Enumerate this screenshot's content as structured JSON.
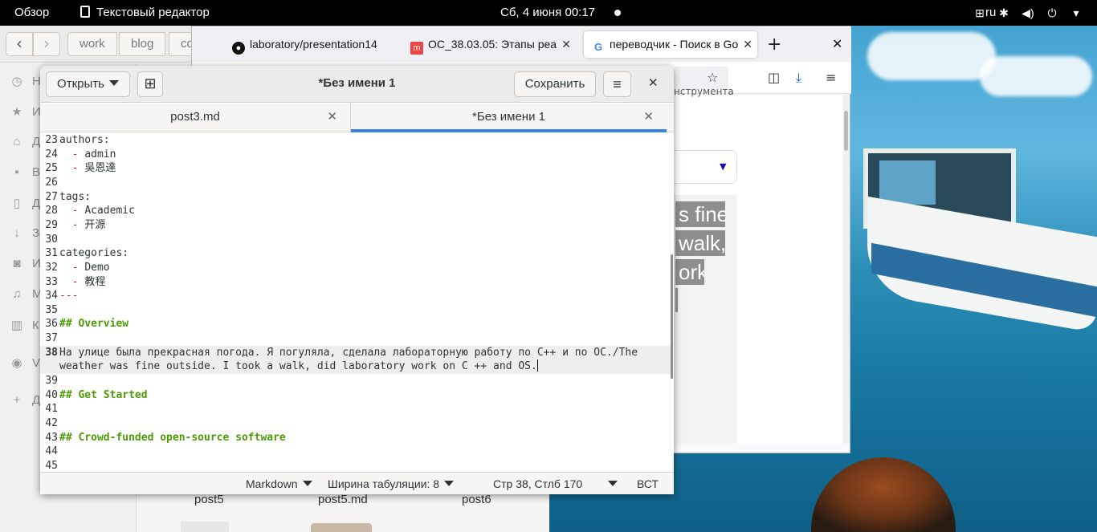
{
  "topbar": {
    "overview": "Обзор",
    "app_name": "Текстовый редактор",
    "datetime": "Сб, 4 июня  00:17",
    "lang": "ru"
  },
  "files": {
    "breadcrumbs": [
      "work",
      "blog",
      "co"
    ],
    "sidebar": [
      {
        "label": "Н",
        "icon": "clock-icon"
      },
      {
        "label": "И",
        "icon": "star-icon"
      },
      {
        "label": "Д",
        "icon": "home-icon"
      },
      {
        "label": "Ви",
        "icon": "video-icon"
      },
      {
        "label": "Д",
        "icon": "document-icon"
      },
      {
        "label": "За",
        "icon": "download-icon"
      },
      {
        "label": "И",
        "icon": "camera-icon"
      },
      {
        "label": "М",
        "icon": "music-icon"
      },
      {
        "label": "К",
        "icon": "trash-icon"
      },
      {
        "label": "VI",
        "icon": "disc-icon"
      },
      {
        "label": "Д",
        "icon": "plus-icon"
      }
    ],
    "items": [
      "post5",
      "post5.md",
      "post6"
    ]
  },
  "firefox": {
    "tabs": [
      {
        "title": "laboratory/presentation14",
        "icon": "github-icon"
      },
      {
        "title": "ОС_38.03.05: Этапы реа",
        "icon": "moodle-icon"
      },
      {
        "title": "переводчик - Поиск в Go",
        "icon": "google-icon"
      }
    ],
    "tool_hint": "нструмента",
    "highlights": [
      "s fine",
      "walk,",
      "ork"
    ]
  },
  "gedit": {
    "open_label": "Открыть",
    "save_label": "Сохранить",
    "title": "*Без имени 1",
    "tabs": [
      {
        "label": "post3.md"
      },
      {
        "label": "*Без имени 1"
      }
    ],
    "lines": [
      {
        "num": "23",
        "text": "authors:"
      },
      {
        "num": "24",
        "dash": "  - ",
        "text": "admin"
      },
      {
        "num": "25",
        "dash": "  - ",
        "text": "吳恩達"
      },
      {
        "num": "26",
        "text": ""
      },
      {
        "num": "27",
        "text": "tags:"
      },
      {
        "num": "28",
        "dash": "  - ",
        "text": "Academic"
      },
      {
        "num": "29",
        "dash": "  - ",
        "text": "开源"
      },
      {
        "num": "30",
        "text": ""
      },
      {
        "num": "31",
        "text": "categories:"
      },
      {
        "num": "32",
        "dash": "  - ",
        "text": "Demo"
      },
      {
        "num": "33",
        "dash": "  - ",
        "text": "教程"
      },
      {
        "num": "34",
        "dash": "---",
        "text": ""
      },
      {
        "num": "35",
        "text": ""
      },
      {
        "num": "36",
        "head": "## Overview"
      },
      {
        "num": "37",
        "text": ""
      },
      {
        "num": "38",
        "text": "На улице была прекрасная погода. Я погуляла, сделала лабораторную работу по C++ и по ОС./The",
        "text2": "weather was fine outside. I took a walk, did laboratory work on C ++ and OS."
      },
      {
        "num": "39",
        "text": ""
      },
      {
        "num": "40",
        "head": "## Get Started"
      },
      {
        "num": "41",
        "text": ""
      },
      {
        "num": "42",
        "text": ""
      },
      {
        "num": "43",
        "head": "## Crowd-funded open-source software"
      },
      {
        "num": "44",
        "text": ""
      },
      {
        "num": "45",
        "text": ""
      }
    ],
    "status": {
      "language": "Markdown",
      "tab_width": "Ширина табуляции: 8",
      "position": "Стр 38, Стлб 170",
      "mode": "ВСТ"
    }
  },
  "colors": {
    "accent": "#3584e4",
    "markdown_heading": "#4e9a06",
    "list_dash": "#c01c28",
    "topbar": "#000000"
  }
}
